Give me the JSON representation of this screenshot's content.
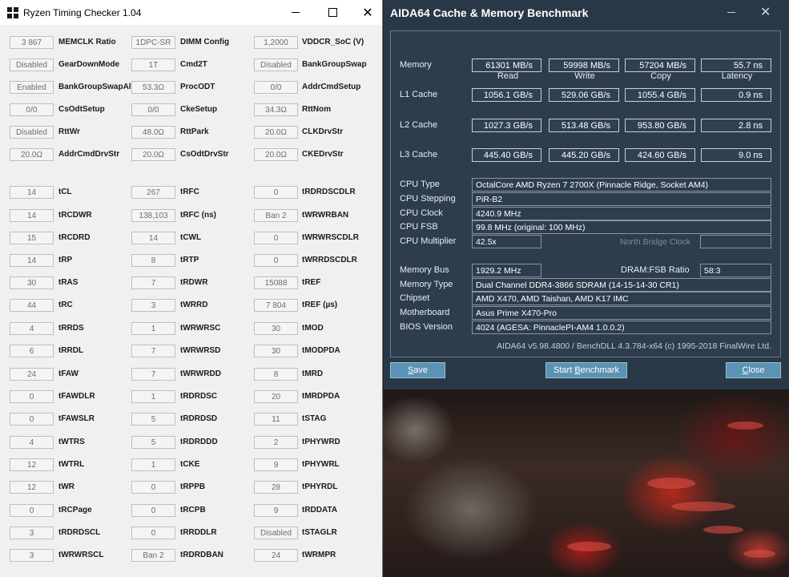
{
  "rtc": {
    "title": "Ryzen Timing Checker 1.04",
    "rows": [
      [
        {
          "v": "3 867",
          "l": "MEMCLK Ratio"
        },
        {
          "v": "1DPC-SR",
          "l": "DIMM Config"
        },
        {
          "v": "1,2000",
          "l": "VDDCR_SoC (V)"
        }
      ],
      [
        {
          "v": "Disabled",
          "l": "GearDownMode"
        },
        {
          "v": "1T",
          "l": "Cmd2T"
        },
        {
          "v": "Disabled",
          "l": "BankGroupSwap"
        }
      ],
      [
        {
          "v": "Enabled",
          "l": "BankGroupSwapAlt"
        },
        {
          "v": "53.3Ω",
          "l": "ProcODT"
        },
        {
          "v": "0/0",
          "l": "AddrCmdSetup"
        }
      ],
      [
        {
          "v": "0/0",
          "l": "CsOdtSetup"
        },
        {
          "v": "0/0",
          "l": "CkeSetup"
        },
        {
          "v": "34.3Ω",
          "l": "RttNom"
        }
      ],
      [
        {
          "v": "Disabled",
          "l": "RttWr"
        },
        {
          "v": "48.0Ω",
          "l": "RttPark"
        },
        {
          "v": "20.0Ω",
          "l": "CLKDrvStr"
        }
      ],
      [
        {
          "v": "20.0Ω",
          "l": "AddrCmdDrvStr"
        },
        {
          "v": "20.0Ω",
          "l": "CsOdtDrvStr"
        },
        {
          "v": "20.0Ω",
          "l": "CKEDrvStr"
        }
      ],
      [
        {
          "v": "14",
          "l": "tCL"
        },
        {
          "v": "267",
          "l": "tRFC"
        },
        {
          "v": "0",
          "l": "tRDRDSCDLR"
        }
      ],
      [
        {
          "v": "14",
          "l": "tRCDWR"
        },
        {
          "v": "138,103",
          "l": "tRFC (ns)"
        },
        {
          "v": "Ban 2",
          "l": "tWRWRBAN"
        }
      ],
      [
        {
          "v": "15",
          "l": "tRCDRD"
        },
        {
          "v": "14",
          "l": "tCWL"
        },
        {
          "v": "0",
          "l": "tWRWRSCDLR"
        }
      ],
      [
        {
          "v": "14",
          "l": "tRP"
        },
        {
          "v": "8",
          "l": "tRTP"
        },
        {
          "v": "0",
          "l": "tWRRDSCDLR"
        }
      ],
      [
        {
          "v": "30",
          "l": "tRAS"
        },
        {
          "v": "7",
          "l": "tRDWR"
        },
        {
          "v": "15088",
          "l": "tREF"
        }
      ],
      [
        {
          "v": "44",
          "l": "tRC"
        },
        {
          "v": "3",
          "l": "tWRRD"
        },
        {
          "v": "7 804",
          "l": "tREF (µs)"
        }
      ],
      [
        {
          "v": "4",
          "l": "tRRDS"
        },
        {
          "v": "1",
          "l": "tWRWRSC"
        },
        {
          "v": "30",
          "l": "tMOD"
        }
      ],
      [
        {
          "v": "6",
          "l": "tRRDL"
        },
        {
          "v": "7",
          "l": "tWRWRSD"
        },
        {
          "v": "30",
          "l": "tMODPDA"
        }
      ],
      [
        {
          "v": "24",
          "l": "tFAW"
        },
        {
          "v": "7",
          "l": "tWRWRDD"
        },
        {
          "v": "8",
          "l": "tMRD"
        }
      ],
      [
        {
          "v": "0",
          "l": "tFAWDLR"
        },
        {
          "v": "1",
          "l": "tRDRDSC"
        },
        {
          "v": "20",
          "l": "tMRDPDA"
        }
      ],
      [
        {
          "v": "0",
          "l": "tFAWSLR"
        },
        {
          "v": "5",
          "l": "tRDRDSD"
        },
        {
          "v": "11",
          "l": "tSTAG"
        }
      ],
      [
        {
          "v": "4",
          "l": "tWTRS"
        },
        {
          "v": "5",
          "l": "tRDRDDD"
        },
        {
          "v": "2",
          "l": "tPHYWRD"
        }
      ],
      [
        {
          "v": "12",
          "l": "tWTRL"
        },
        {
          "v": "1",
          "l": "tCKE"
        },
        {
          "v": "9",
          "l": "tPHYWRL"
        }
      ],
      [
        {
          "v": "12",
          "l": "tWR"
        },
        {
          "v": "0",
          "l": "tRPPB"
        },
        {
          "v": "28",
          "l": "tPHYRDL"
        }
      ],
      [
        {
          "v": "0",
          "l": "tRCPage"
        },
        {
          "v": "0",
          "l": "tRCPB"
        },
        {
          "v": "9",
          "l": "tRDDATA"
        }
      ],
      [
        {
          "v": "3",
          "l": "tRDRDSCL"
        },
        {
          "v": "0",
          "l": "tRRDDLR"
        },
        {
          "v": "Disabled",
          "l": "tSTAGLR"
        }
      ],
      [
        {
          "v": "3",
          "l": "tWRWRSCL"
        },
        {
          "v": "Ban 2",
          "l": "tRDRDBAN"
        },
        {
          "v": "24",
          "l": "tWRMPR"
        }
      ]
    ]
  },
  "aida": {
    "title": "AIDA64 Cache & Memory Benchmark",
    "columns": [
      "Read",
      "Write",
      "Copy",
      "Latency"
    ],
    "bench": [
      {
        "label": "Memory",
        "values": [
          "61301 MB/s",
          "59998 MB/s",
          "57204 MB/s",
          "55.7 ns"
        ]
      },
      {
        "label": "L1 Cache",
        "values": [
          "1056.1 GB/s",
          "529.06 GB/s",
          "1055.4 GB/s",
          "0.9 ns"
        ]
      },
      {
        "label": "L2 Cache",
        "values": [
          "1027.3 GB/s",
          "513.48 GB/s",
          "953.80 GB/s",
          "2.8 ns"
        ]
      },
      {
        "label": "L3 Cache",
        "values": [
          "445.40 GB/s",
          "445.20 GB/s",
          "424.60 GB/s",
          "9.0 ns"
        ]
      }
    ],
    "cpu_type_label": "CPU Type",
    "cpu_type": "OctalCore AMD Ryzen 7 2700X  (Pinnacle Ridge, Socket AM4)",
    "cpu_stepping_label": "CPU Stepping",
    "cpu_stepping": "PiR-B2",
    "cpu_clock_label": "CPU Clock",
    "cpu_clock": "4240.9 MHz",
    "cpu_fsb_label": "CPU FSB",
    "cpu_fsb": "99.8 MHz  (original: 100 MHz)",
    "cpu_mult_label": "CPU Multiplier",
    "cpu_mult": "42.5x",
    "nb_clock_label": "North Bridge Clock",
    "mem_bus_label": "Memory Bus",
    "mem_bus": "1929.2 MHz",
    "dram_fsb_label": "DRAM:FSB Ratio",
    "dram_fsb": "58:3",
    "mem_type_label": "Memory Type",
    "mem_type": "Dual Channel DDR4-3866 SDRAM  (14-15-14-30 CR1)",
    "chipset_label": "Chipset",
    "chipset": "AMD X470, AMD Taishan, AMD K17 IMC",
    "mobo_label": "Motherboard",
    "mobo": "Asus Prime X470-Pro",
    "bios_label": "BIOS Version",
    "bios": "4024  (AGESA: PinnaclePI-AM4 1.0.0.2)",
    "footer": "AIDA64 v5.98.4800 / BenchDLL 4.3.784-x64  (c) 1995-2018 FinalWire Ltd.",
    "save_first": "S",
    "save_rest": "ave",
    "start_pre": "Start ",
    "start_ul": "B",
    "start_post": "enchmark",
    "close_first": "C",
    "close_rest": "lose"
  }
}
